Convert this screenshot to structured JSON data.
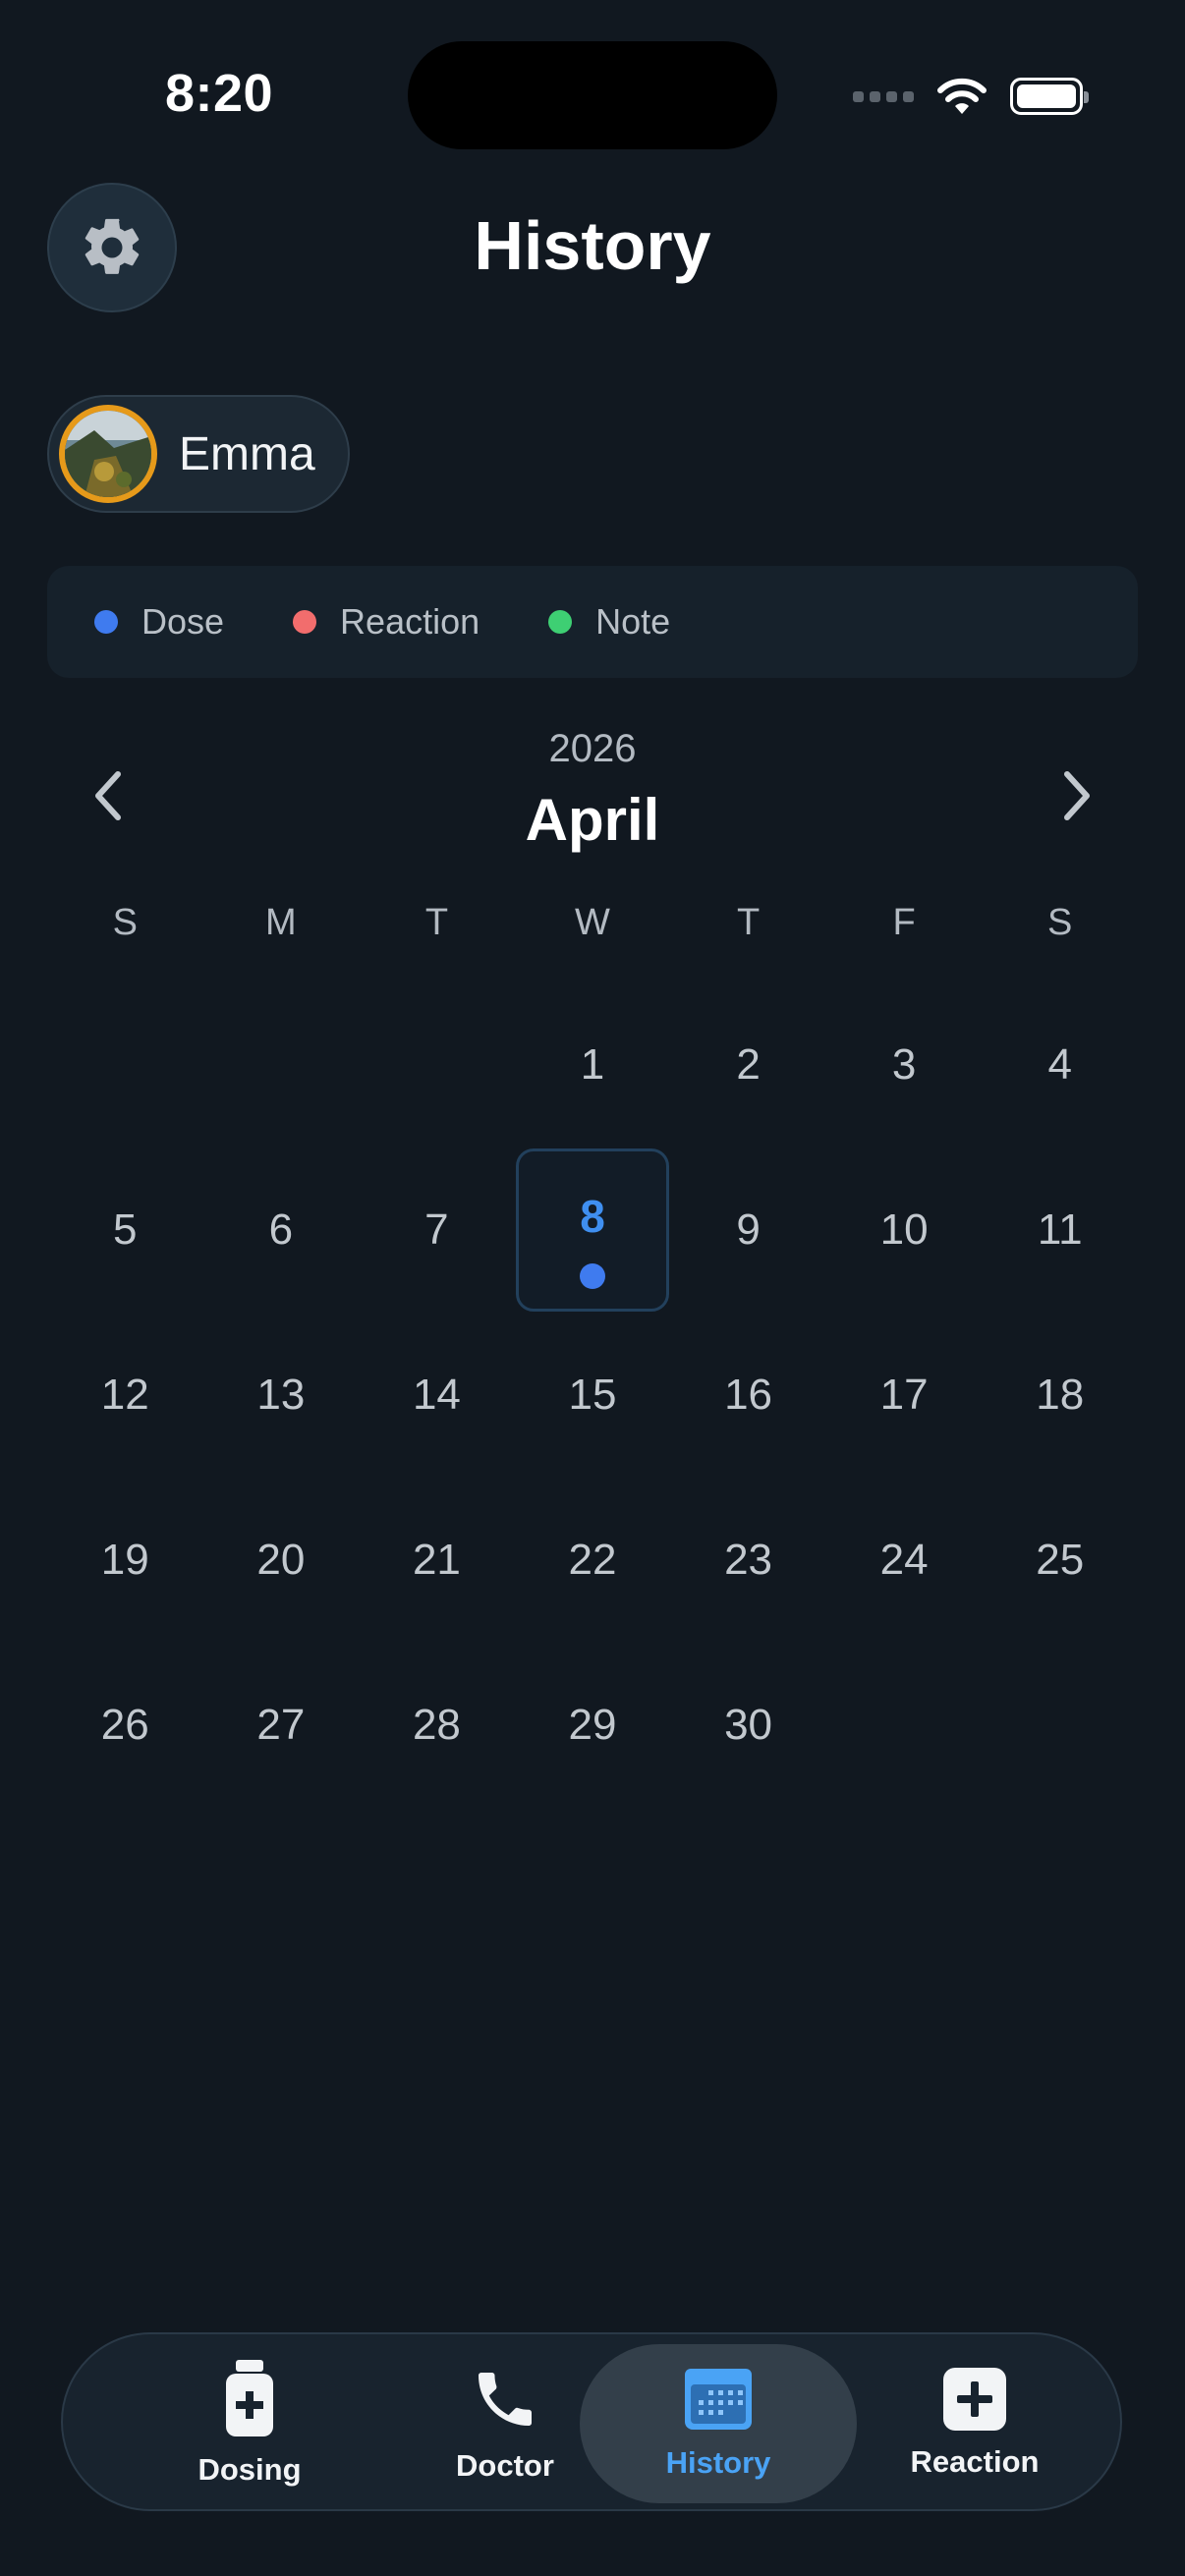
{
  "status_bar": {
    "time": "8:20"
  },
  "header": {
    "title": "History"
  },
  "profile": {
    "name": "Emma"
  },
  "legend": [
    {
      "label": "Dose",
      "color": "#3f7bef"
    },
    {
      "label": "Reaction",
      "color": "#f26d6d"
    },
    {
      "label": "Note",
      "color": "#3ecf73"
    }
  ],
  "calendar": {
    "year": "2026",
    "month": "April",
    "weekdays": [
      "S",
      "M",
      "T",
      "W",
      "T",
      "F",
      "S"
    ],
    "first_weekday_index": 3,
    "days_in_month": 30,
    "selected_day": 8,
    "days_with_dose": [
      8
    ]
  },
  "tabbar": {
    "active": "History",
    "tabs": [
      {
        "label": "Dosing",
        "icon": "medicine-bottle-icon"
      },
      {
        "label": "Doctor",
        "icon": "phone-icon"
      },
      {
        "label": "History",
        "icon": "calendar-icon"
      },
      {
        "label": "Reaction",
        "icon": "plus-square-icon"
      }
    ]
  },
  "colors": {
    "background": "#111820",
    "accent": "#4aa3f5",
    "dose": "#3f7bef"
  }
}
